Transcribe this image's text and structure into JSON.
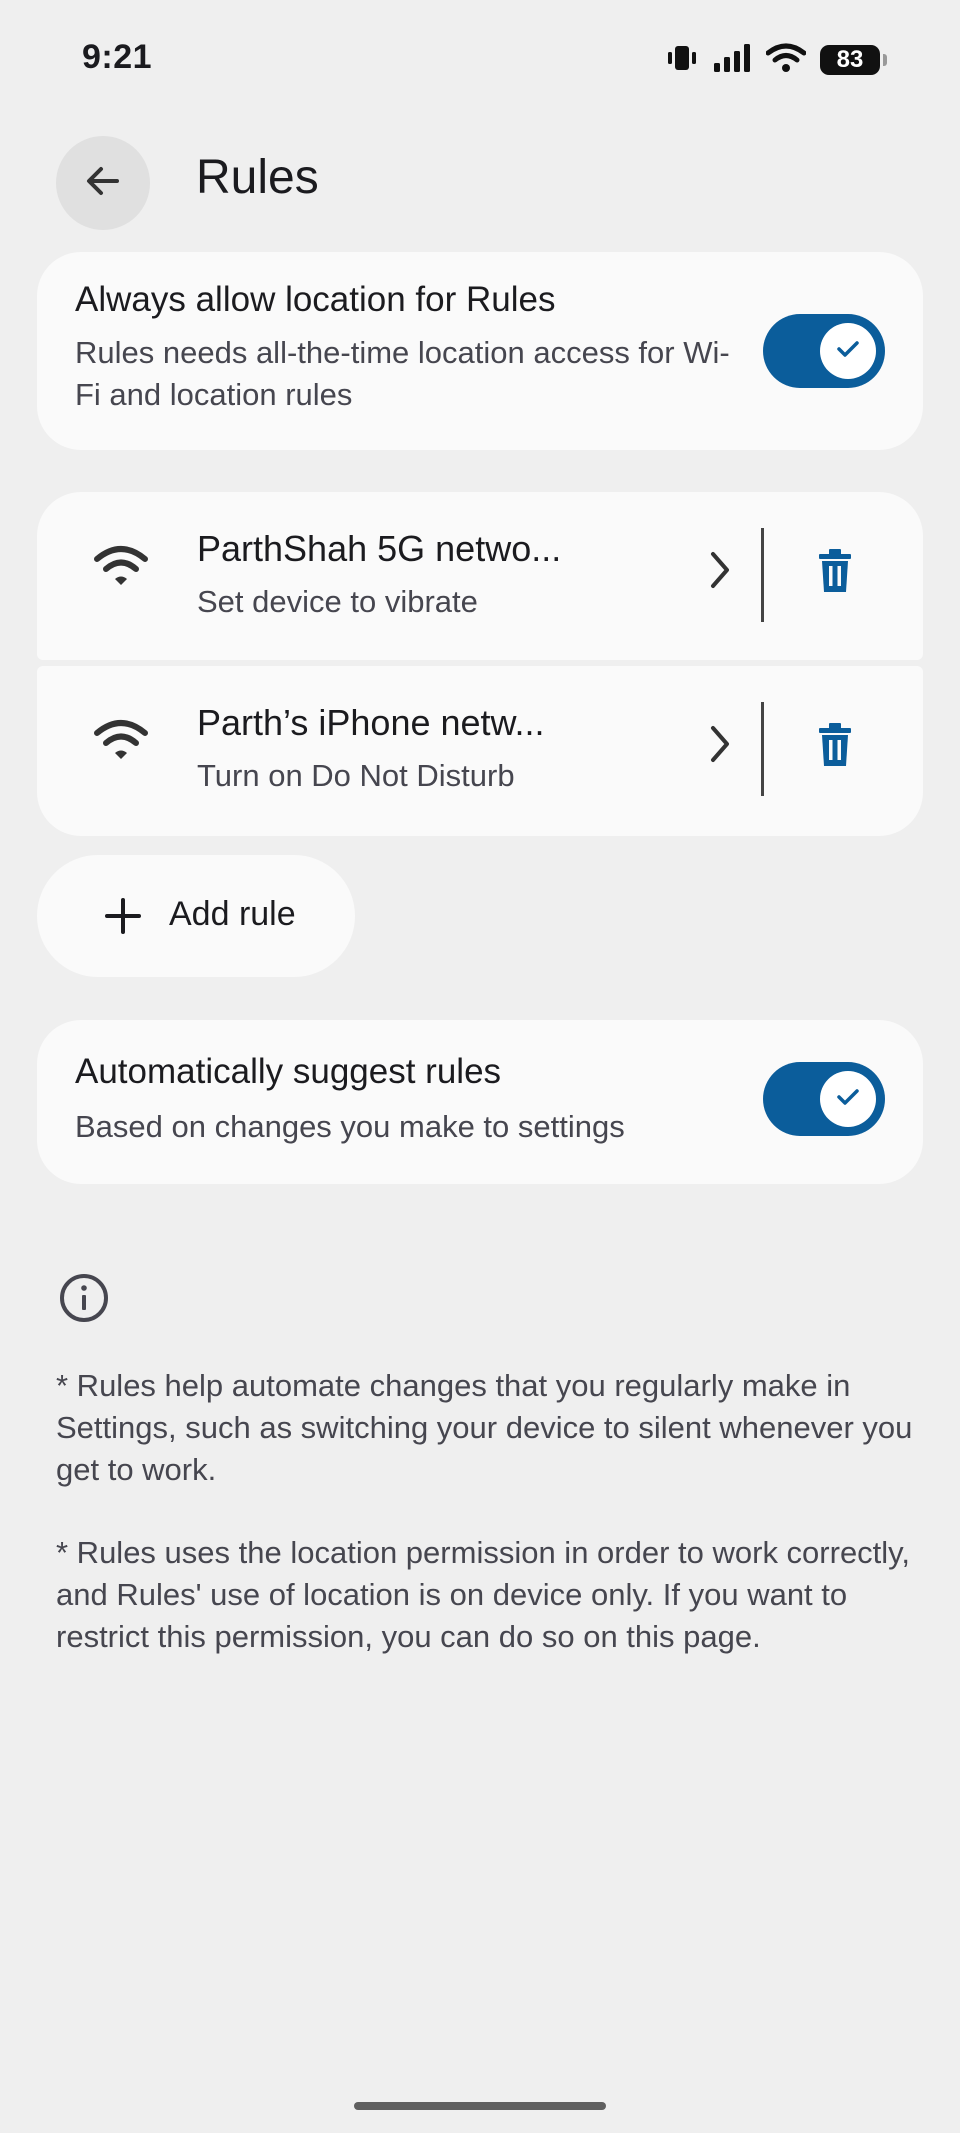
{
  "status_bar": {
    "time": "9:21",
    "battery": "83",
    "icons": [
      "vibrate-icon",
      "signal-icon",
      "wifi-icon",
      "battery-icon"
    ]
  },
  "header": {
    "back_icon": "arrow-back-icon",
    "title": "Rules"
  },
  "location_setting": {
    "title": "Always allow location for Rules",
    "subtitle": "Rules needs all-the-time location access for Wi-Fi and location rules",
    "enabled": true
  },
  "rules": [
    {
      "icon": "wifi-icon",
      "title": "ParthShah 5G netwo...",
      "subtitle": "Set device to vibrate"
    },
    {
      "icon": "wifi-icon",
      "title": "Parth’s iPhone netw...",
      "subtitle": "Turn on Do Not Disturb"
    }
  ],
  "add_rule": {
    "label": "Add rule",
    "icon": "plus-icon"
  },
  "suggest_setting": {
    "title": "Automatically suggest rules",
    "subtitle": "Based on changes you make to settings",
    "enabled": true
  },
  "footer": {
    "info_icon": "info-icon",
    "paragraph_1": "* Rules help automate changes that you regularly make in Settings, such as switching your device to silent whenever you get to work.",
    "paragraph_2": "* Rules uses the location permission in order to work correctly, and Rules' use of location is on device only. If you want to restrict this permission, you can do so on this page."
  },
  "colors": {
    "accent": "#0b5d9b",
    "background": "#efefef",
    "card": "#fafafa",
    "delete_icon": "#0b5d9b"
  }
}
